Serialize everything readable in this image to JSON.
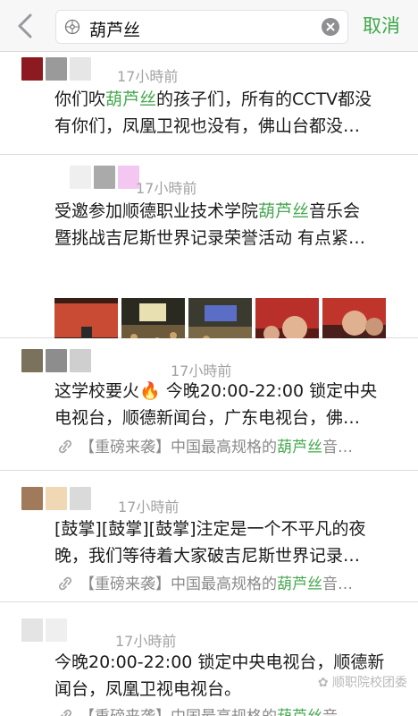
{
  "search": {
    "query": "葫芦丝",
    "cancel_label": "取消"
  },
  "posts": [
    {
      "time": "17小時前",
      "line1": [
        "你们吹",
        "葫芦丝",
        "的孩子们，所有的CCTV都没"
      ],
      "line2": "有你们，凤凰卫视也没有，佛山台都没…"
    },
    {
      "time": "17小時前",
      "line1": [
        "受邀参加顺德职业技术学院",
        "葫芦丝",
        "音乐会"
      ],
      "line2": "暨挑战吉尼斯世界记录荣誉活动 有点紧…"
    },
    {
      "time": "17小時前",
      "line1": [
        "这学校要火",
        "🔥",
        " 今晚20:00-22:00 锁定中央"
      ],
      "line2": "电视台，顺德新闻台，广东电视台，佛…",
      "link": [
        "【重磅来袭】中国最高规格的",
        "葫芦丝",
        "音…"
      ]
    },
    {
      "time": "17小時前",
      "line1": [
        "[鼓掌][鼓掌][鼓掌]注定是一个不平凡的夜"
      ],
      "line2": "晚，我们等待着大家破吉尼斯世界记录…",
      "link": [
        "【重磅来袭】中国最高规格的",
        "葫芦丝",
        "音…"
      ]
    },
    {
      "time": "17小時前",
      "line1": [
        "今晚20:00-22:00 锁定中央电视台，顺德新"
      ],
      "line2": "闻台，凤凰卫视电视台。",
      "link": [
        "【重磅来袭】中国最高规格的",
        "葫芦丝",
        "音…"
      ]
    }
  ],
  "watermark": "顺职院校团委",
  "icons": {
    "back": "chevron-left-icon",
    "search": "search-icon",
    "clear": "clear-icon",
    "link": "link-icon"
  },
  "colors": {
    "accent": "#3ea84a",
    "highlight": "#46a84f"
  }
}
